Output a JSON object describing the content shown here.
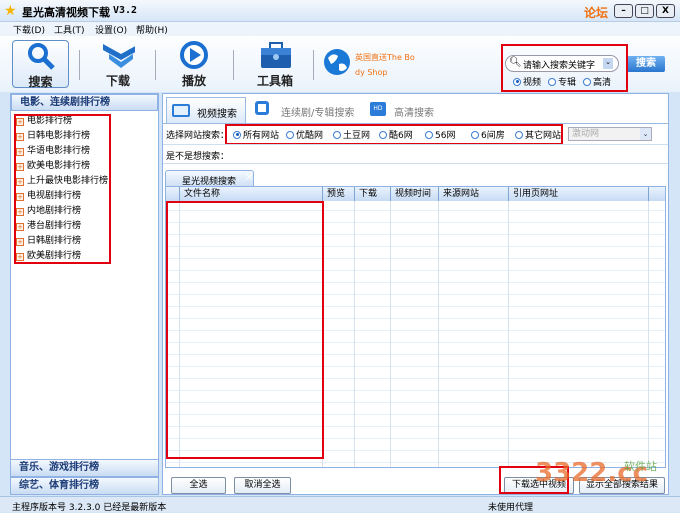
{
  "window": {
    "title": "星光高清视频下载",
    "version": "V3.2",
    "forum_link": "论坛",
    "min": "–",
    "max": "□",
    "close": "X"
  },
  "menu": [
    "下载(D)",
    "工具(T)",
    "设置(O)",
    "帮助(H)"
  ],
  "toolbar": {
    "buttons": [
      "搜索",
      "下载",
      "播放",
      "工具箱"
    ],
    "ad_text_1": "英国直送The Bo",
    "ad_text_2": "dy Shop"
  },
  "search": {
    "placeholder": "请输入搜索关键字",
    "button": "搜索",
    "types": [
      "视频",
      "专辑",
      "高清"
    ],
    "selected_type": "视频"
  },
  "sidebar": {
    "section1": "电影、连续剧排行榜",
    "items": [
      "电影排行榜",
      "日韩电影排行榜",
      "华语电影排行榜",
      "欧美电影排行榜",
      "上升最快电影排行榜",
      "电视剧排行榜",
      "内地剧排行榜",
      "港台剧排行榜",
      "日韩剧排行榜",
      "欧美剧排行榜"
    ],
    "section2": "音乐、游戏排行榜",
    "section3": "综艺、体育排行榜"
  },
  "tabs": [
    "视频搜索",
    "连续剧/专辑搜索",
    "高清搜索"
  ],
  "site_filter": {
    "label": "选择网站搜索：",
    "options": [
      "所有网站",
      "优酷网",
      "土豆网",
      "酷6网",
      "56网",
      "6间房",
      "其它网站"
    ],
    "selected": "所有网站",
    "dropdown": "激动网"
  },
  "suggest_label": "是不是想搜索：",
  "result_tab": {
    "label": "星光视频搜索",
    "close": "×"
  },
  "table": {
    "columns": [
      "文件名称",
      "预览",
      "下载",
      "视频时间",
      "来源网站",
      "引用页网址"
    ],
    "rows": []
  },
  "buttons": {
    "select_all": "全选",
    "deselect_all": "取消全选",
    "download_selected": "下载选中视频",
    "show_all": "显示全部搜索结果"
  },
  "status": {
    "version": "主程序版本号 3.2.3.0  已经是最新版本",
    "proxy": "未使用代理"
  },
  "watermark": {
    "text": "3322.cc",
    "sub": "软件站"
  }
}
